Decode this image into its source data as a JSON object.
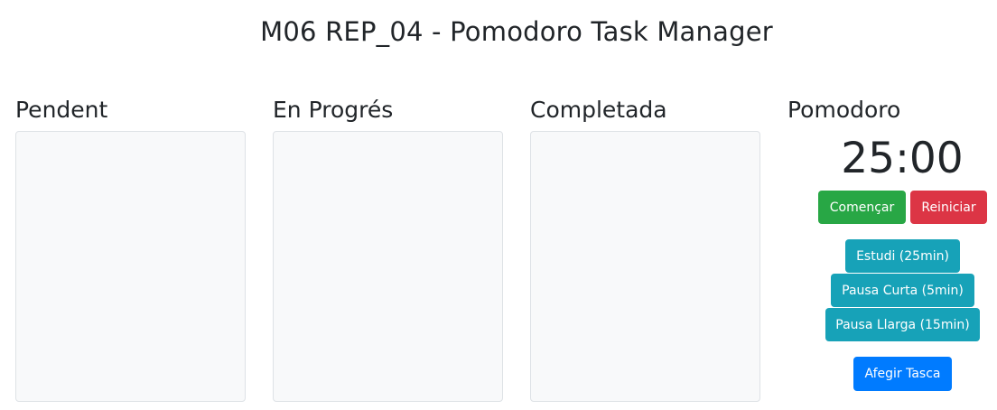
{
  "header": {
    "title": "M06 REP_04 - Pomodoro Task Manager"
  },
  "columns": [
    {
      "title": "Pendent"
    },
    {
      "title": "En Progrés"
    },
    {
      "title": "Completada"
    }
  ],
  "pomodoro": {
    "title": "Pomodoro",
    "timer": "25:00",
    "start_label": "Començar",
    "reset_label": "Reiniciar",
    "modes": [
      {
        "label": "Estudi (25min)"
      },
      {
        "label": "Pausa Curta (5min)"
      },
      {
        "label": "Pausa Llarga (15min)"
      }
    ]
  },
  "actions": {
    "add_task_label": "Afegir Tasca"
  },
  "colors": {
    "start": "#28a745",
    "reset": "#dc3545",
    "mode": "#17a2b8",
    "add": "#007bff",
    "column_bg": "#f8f9fa",
    "column_border": "#dee2e6"
  }
}
